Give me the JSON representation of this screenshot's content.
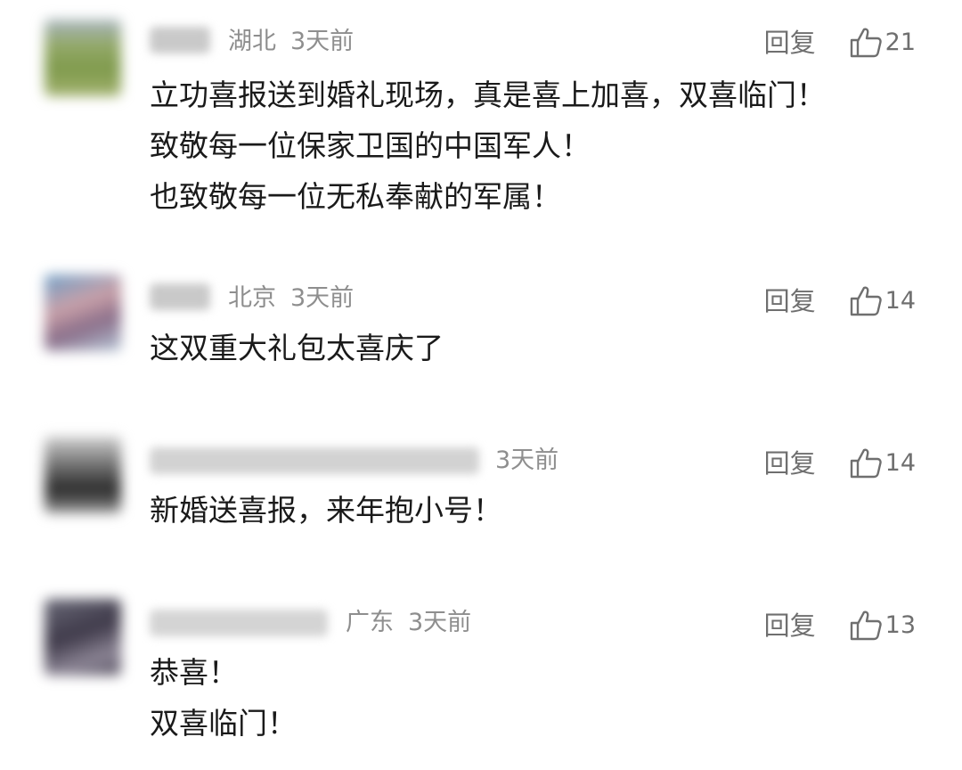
{
  "comments": [
    {
      "location": "湖北",
      "time": "3天前",
      "reply_label": "回复",
      "likes": "21",
      "lines": [
        "立功喜报送到婚礼现场，真是喜上加喜，双喜临门！",
        "致敬每一位保家卫国的中国军人！",
        "也致敬每一位无私奉献的军属！"
      ]
    },
    {
      "location": "北京",
      "time": "3天前",
      "reply_label": "回复",
      "likes": "14",
      "lines": [
        "这双重大礼包太喜庆了"
      ]
    },
    {
      "location": "",
      "time": "3天前",
      "reply_label": "回复",
      "likes": "14",
      "lines": [
        "新婚送喜报，来年抱小号！"
      ]
    },
    {
      "location": "广东",
      "time": "3天前",
      "reply_label": "回复",
      "likes": "13",
      "lines": [
        "恭喜！",
        "双喜临门！"
      ]
    }
  ],
  "icons": {
    "like": "thumbs-up-outline-icon"
  },
  "colors": {
    "text": "#1a1a1a",
    "meta": "#8e8e8e",
    "action": "#6f6f6f"
  }
}
